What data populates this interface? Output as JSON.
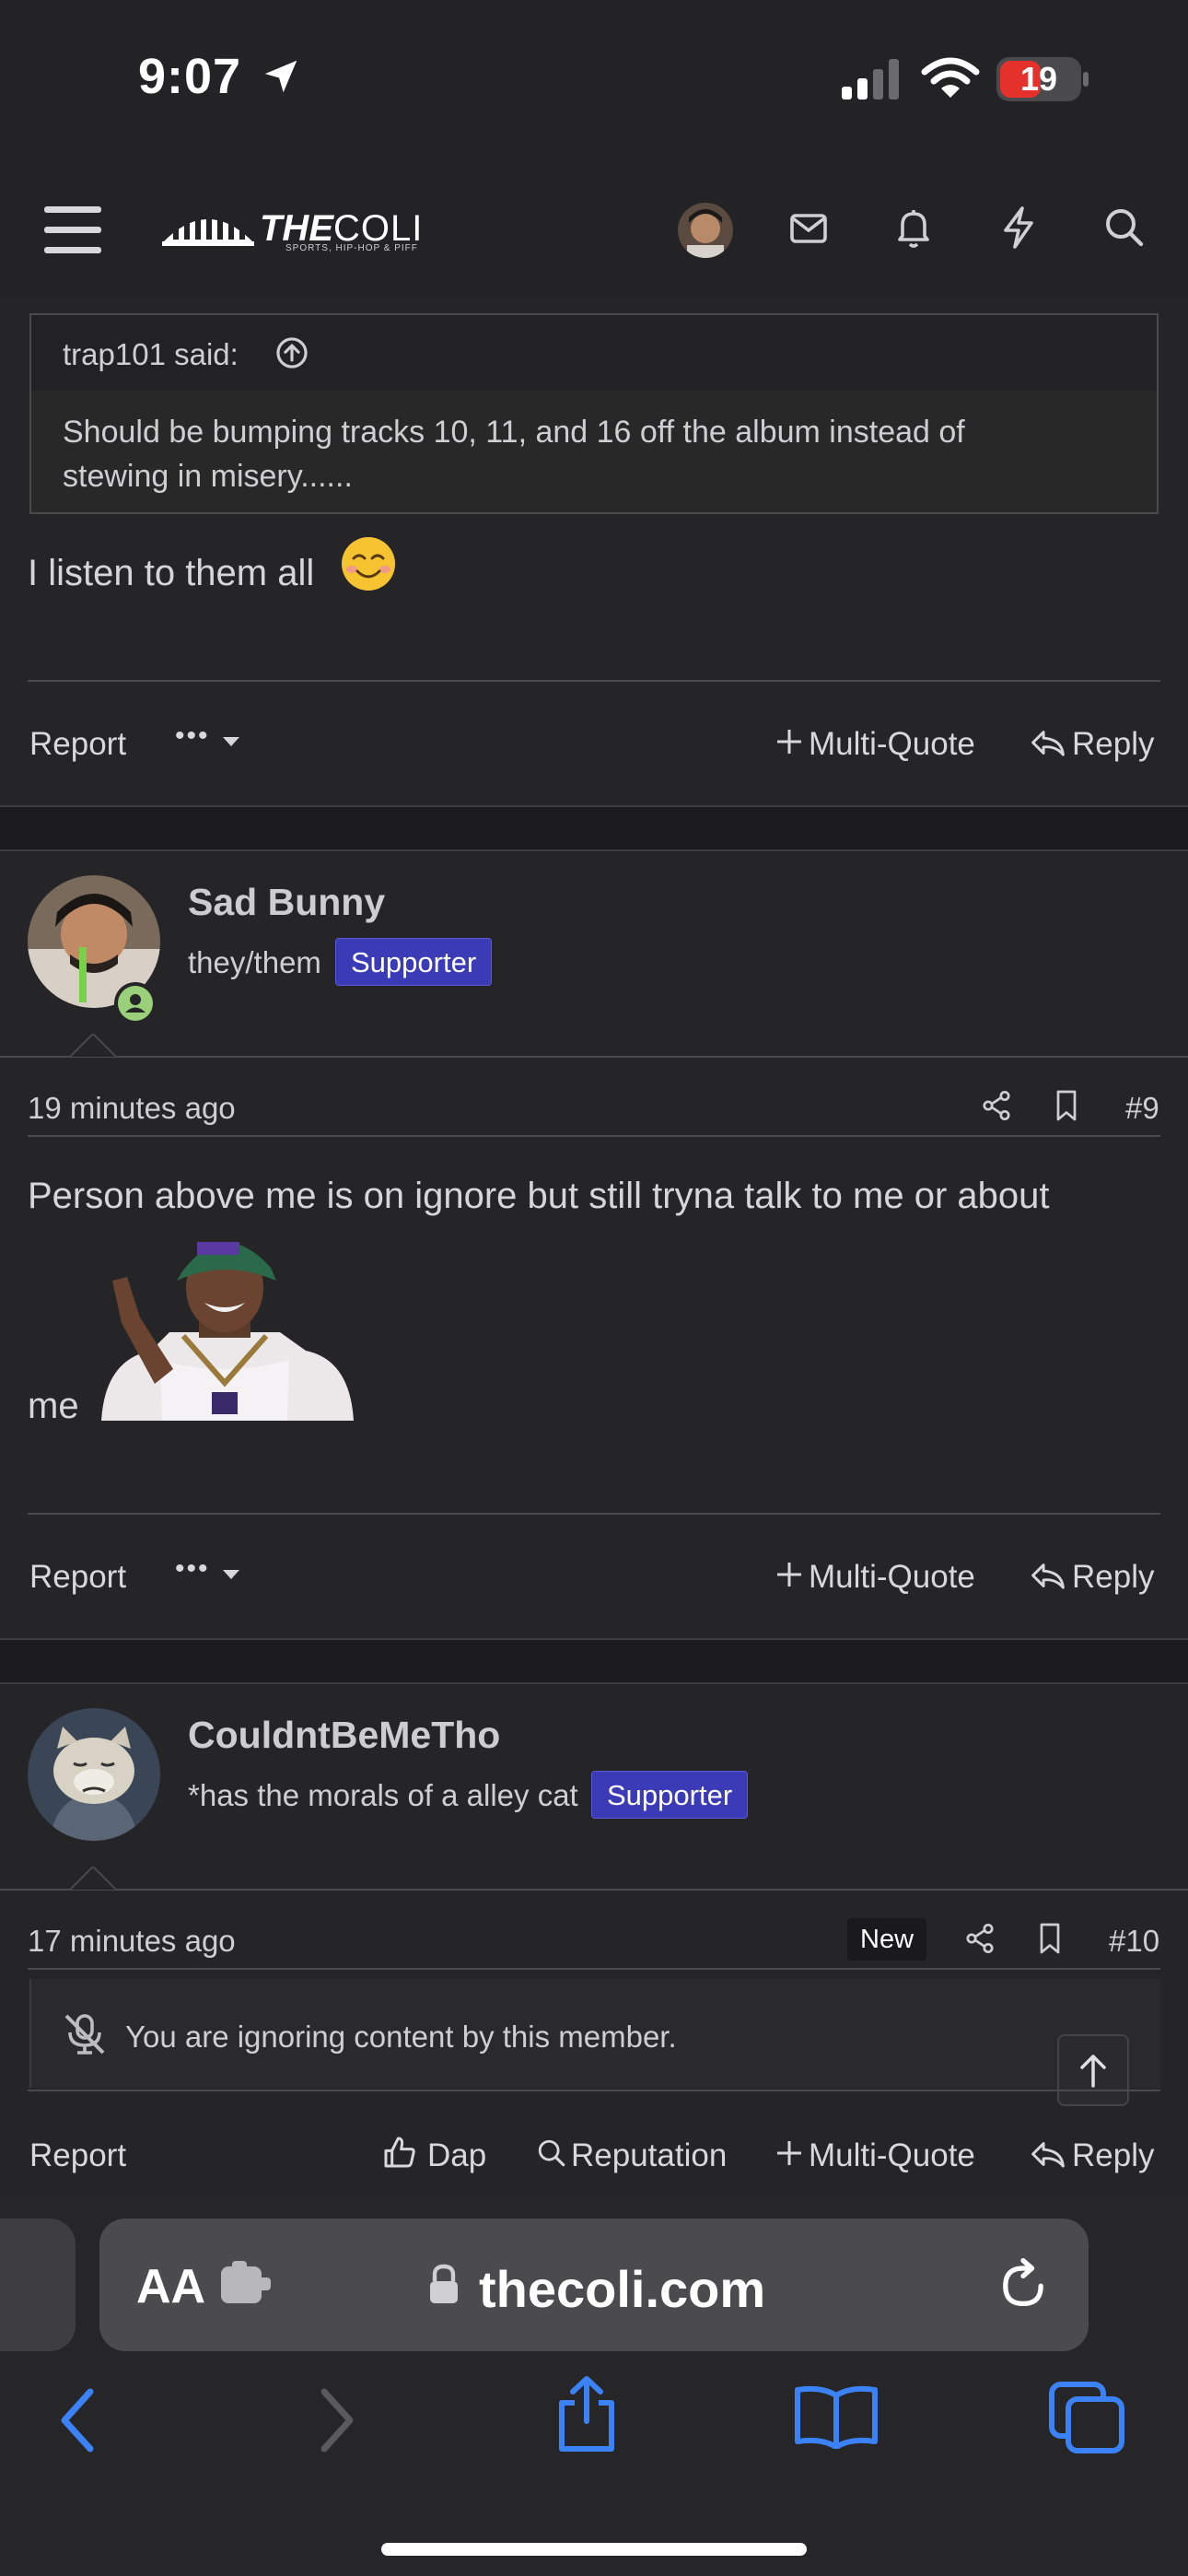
{
  "status_bar": {
    "time": "9:07",
    "battery": "19",
    "icons": [
      "location-arrow-icon",
      "signal-icon",
      "wifi-icon",
      "battery-icon"
    ]
  },
  "header": {
    "logo_the": "THE",
    "logo_coli": "COLI",
    "logo_sub": "SPORTS, HIP-HOP & PIFF",
    "icons": [
      "menu-icon",
      "avatar",
      "mail-icon",
      "bell-icon",
      "bolt-icon",
      "search-icon"
    ]
  },
  "post8": {
    "quote_author": "trap101 said:",
    "quote_line1": "Should be bumping tracks 10, 11, and 16 off the album instead of",
    "quote_line2": "stewing in misery......",
    "body": "I listen to them all",
    "emoji": "☺️",
    "actions": {
      "report": "Report",
      "more": "•••",
      "multi_quote": "Multi-Quote",
      "reply": "Reply"
    }
  },
  "post9": {
    "username": "Sad Bunny",
    "title": "they/them",
    "badge": "Supporter",
    "time": "19 minutes ago",
    "number": "#9",
    "body_line1": "Person above me is on ignore but still tryna talk to me or about",
    "body_line2": "me",
    "actions": {
      "report": "Report",
      "more": "•••",
      "multi_quote": "Multi-Quote",
      "reply": "Reply"
    }
  },
  "post10": {
    "username": "CouldntBeMeTho",
    "title": "*has the morals of a alley cat",
    "badge": "Supporter",
    "time": "17 minutes ago",
    "new_label": "New",
    "number": "#10",
    "ignore_text": "You are ignoring content by this member.",
    "actions": {
      "report": "Report",
      "dap": "Dap",
      "reputation": "Reputation",
      "multi_quote": "Multi-Quote",
      "reply": "Reply"
    }
  },
  "safari": {
    "aa": "AA",
    "url": "thecoli.com",
    "icons": [
      "back-icon",
      "forward-icon",
      "share-icon",
      "bookmarks-icon",
      "tabs-icon"
    ]
  },
  "colors": {
    "accent_blue": "#3b82f6",
    "badge_blue": "#3b3bb8",
    "battery_red": "#e5312b",
    "online_green": "#9ad07a"
  }
}
